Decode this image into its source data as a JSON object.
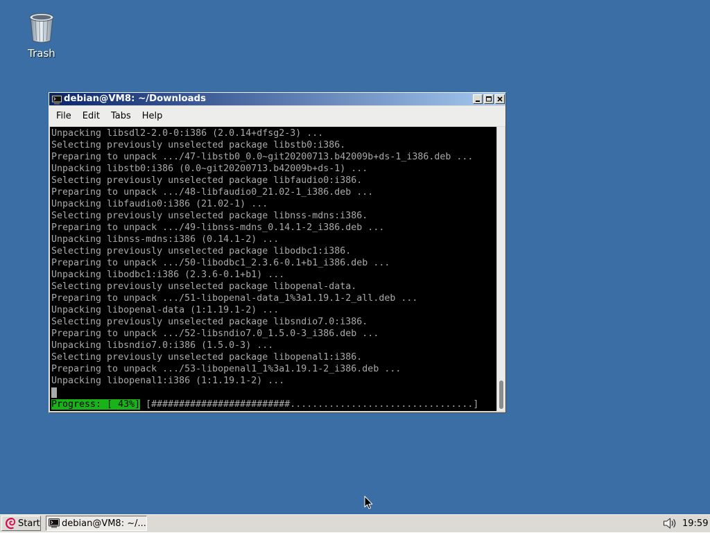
{
  "theme": {
    "desktop_bg": "#3a6ea5",
    "titlebar_start": "#0a246a",
    "titlebar_end": "#a6caf0",
    "terminal_bg": "#000000",
    "terminal_fg": "#aaaaaa",
    "progress_bg": "#19b219",
    "debian_red": "#d70751"
  },
  "desktop": {
    "icons": [
      {
        "icon": "trash-icon",
        "label": "Trash"
      }
    ]
  },
  "window": {
    "icon": "terminal-icon",
    "title": "debian@VM8: ~/Downloads",
    "controls": [
      {
        "icon": "minimize-icon"
      },
      {
        "icon": "maximize-icon"
      },
      {
        "icon": "close-icon"
      }
    ],
    "menu": [
      {
        "label": "File"
      },
      {
        "label": "Edit"
      },
      {
        "label": "Tabs"
      },
      {
        "label": "Help"
      }
    ],
    "terminal": {
      "lines": [
        "Unpacking libsdl2-2.0-0:i386 (2.0.14+dfsg2-3) ...",
        "Selecting previously unselected package libstb0:i386.",
        "Preparing to unpack .../47-libstb0_0.0~git20200713.b42009b+ds-1_i386.deb ...",
        "Unpacking libstb0:i386 (0.0~git20200713.b42009b+ds-1) ...",
        "Selecting previously unselected package libfaudio0:i386.",
        "Preparing to unpack .../48-libfaudio0_21.02-1_i386.deb ...",
        "Unpacking libfaudio0:i386 (21.02-1) ...",
        "Selecting previously unselected package libnss-mdns:i386.",
        "Preparing to unpack .../49-libnss-mdns_0.14.1-2_i386.deb ...",
        "Unpacking libnss-mdns:i386 (0.14.1-2) ...",
        "Selecting previously unselected package libodbc1:i386.",
        "Preparing to unpack .../50-libodbc1_2.3.6-0.1+b1_i386.deb ...",
        "Unpacking libodbc1:i386 (2.3.6-0.1+b1) ...",
        "Selecting previously unselected package libopenal-data.",
        "Preparing to unpack .../51-libopenal-data_1%3a1.19.1-2_all.deb ...",
        "Unpacking libopenal-data (1:1.19.1-2) ...",
        "Selecting previously unselected package libsndio7.0:i386.",
        "Preparing to unpack .../52-libsndio7.0_1.5.0-3_i386.deb ...",
        "Unpacking libsndio7.0:i386 (1.5.0-3) ...",
        "Selecting previously unselected package libopenal1:i386.",
        "Preparing to unpack .../53-libopenal1_1%3a1.19.1-2_i386.deb ...",
        "Unpacking libopenal1:i386 (1:1.19.1-2) ..."
      ],
      "progress": {
        "label": "Progress: [ 43%]",
        "bar": "[#########################.................................]"
      }
    }
  },
  "taskbar": {
    "start": {
      "icon": "debian-logo-icon",
      "label": "Start"
    },
    "tasks": [
      {
        "icon": "terminal-icon",
        "label": "debian@VM8: ~/...",
        "active": true
      }
    ],
    "tray": {
      "icon": "volume-icon",
      "clock": "19:59"
    }
  }
}
